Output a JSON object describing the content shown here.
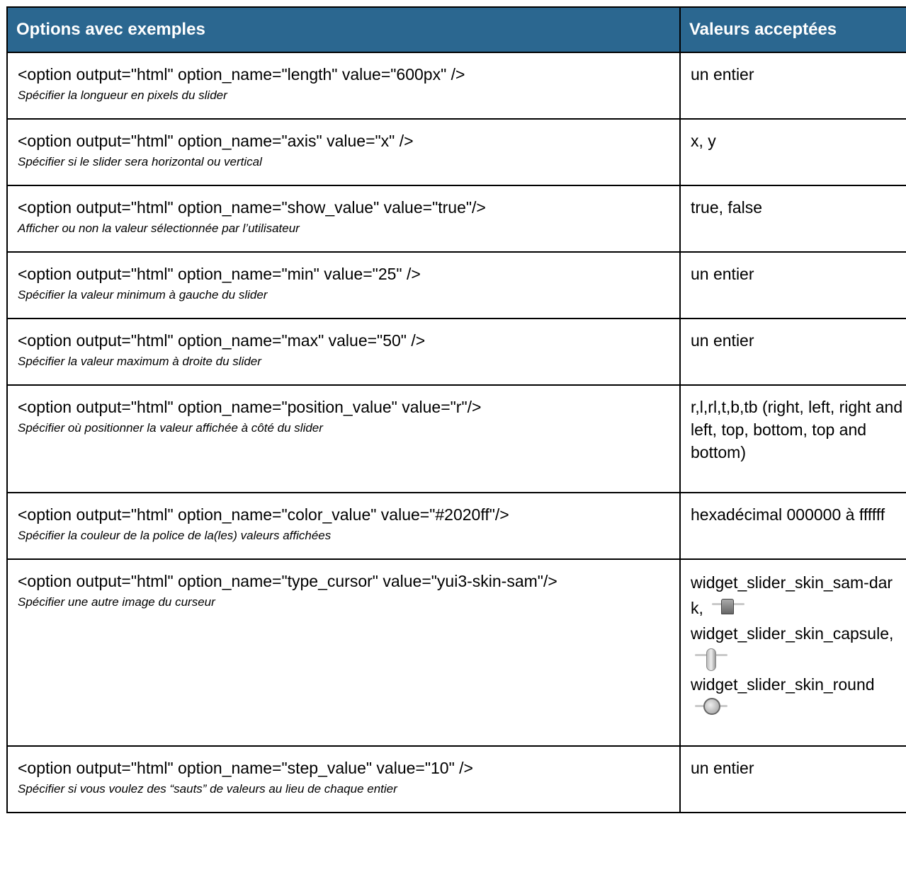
{
  "header": {
    "col1": "Options avec exemples",
    "col2": "Valeurs acceptées"
  },
  "rows": [
    {
      "code": "<option output=\"html\" option_name=\"length\" value=\"600px\" />",
      "desc": "Spécifier la longueur en pixels du slider",
      "accepted": "un entier"
    },
    {
      "code": "<option output=\"html\" option_name=\"axis\" value=\"x\" />",
      "desc": "Spécifier si le slider sera horizontal ou vertical",
      "accepted": "x, y"
    },
    {
      "code": "<option output=\"html\" option_name=\"show_value\" value=\"true\"/>",
      "desc": "Afficher ou non la valeur sélectionnée par l’utilisateur",
      "accepted": "true, false"
    },
    {
      "code": "<option output=\"html\" option_name=\"min\" value=\"25\" />",
      "desc": "Spécifier la valeur minimum à gauche du slider",
      "accepted": "un entier"
    },
    {
      "code": "<option output=\"html\" option_name=\"max\" value=\"50\" />",
      "desc": "Spécifier la valeur maximum à droite du slider",
      "accepted": "un entier"
    },
    {
      "code": "<option output=\"html\" option_name=\"position_value\" value=\"r\"/>",
      "desc": "Spécifier où positionner la valeur affichée à côté du slider",
      "accepted": "r,l,rl,t,b,tb (right, left, right and left, top, bottom, top and bottom)"
    },
    {
      "code": "<option output=\"html\" option_name=\"color_value\" value=\"#2020ff\"/>",
      "desc": "Spécifier la couleur de la police de la(les) valeurs affichées",
      "accepted": "hexadécimal 000000 à ffffff"
    },
    {
      "code": "<option output=\"html\" option_name=\"type_cursor\" value=\"yui3-skin-sam\"/>",
      "desc": "Spécifier une autre image du curseur",
      "skins": [
        "widget_slider_skin_sam-dark,",
        "widget_slider_skin_capsule,",
        "widget_slider_skin_round"
      ]
    },
    {
      "code": "<option output=\"html\" option_name=\"step_value\" value=\"10\" />",
      "desc": "Spécifier si vous voulez des “sauts” de valeurs au lieu de chaque entier",
      "accepted": "un entier"
    }
  ],
  "colors": {
    "header_bg": "#2b6790",
    "header_text": "#ffffff",
    "border": "#000000"
  },
  "icons": [
    "slider-skin-sam-dark-icon",
    "slider-skin-capsule-icon",
    "slider-skin-round-icon"
  ]
}
